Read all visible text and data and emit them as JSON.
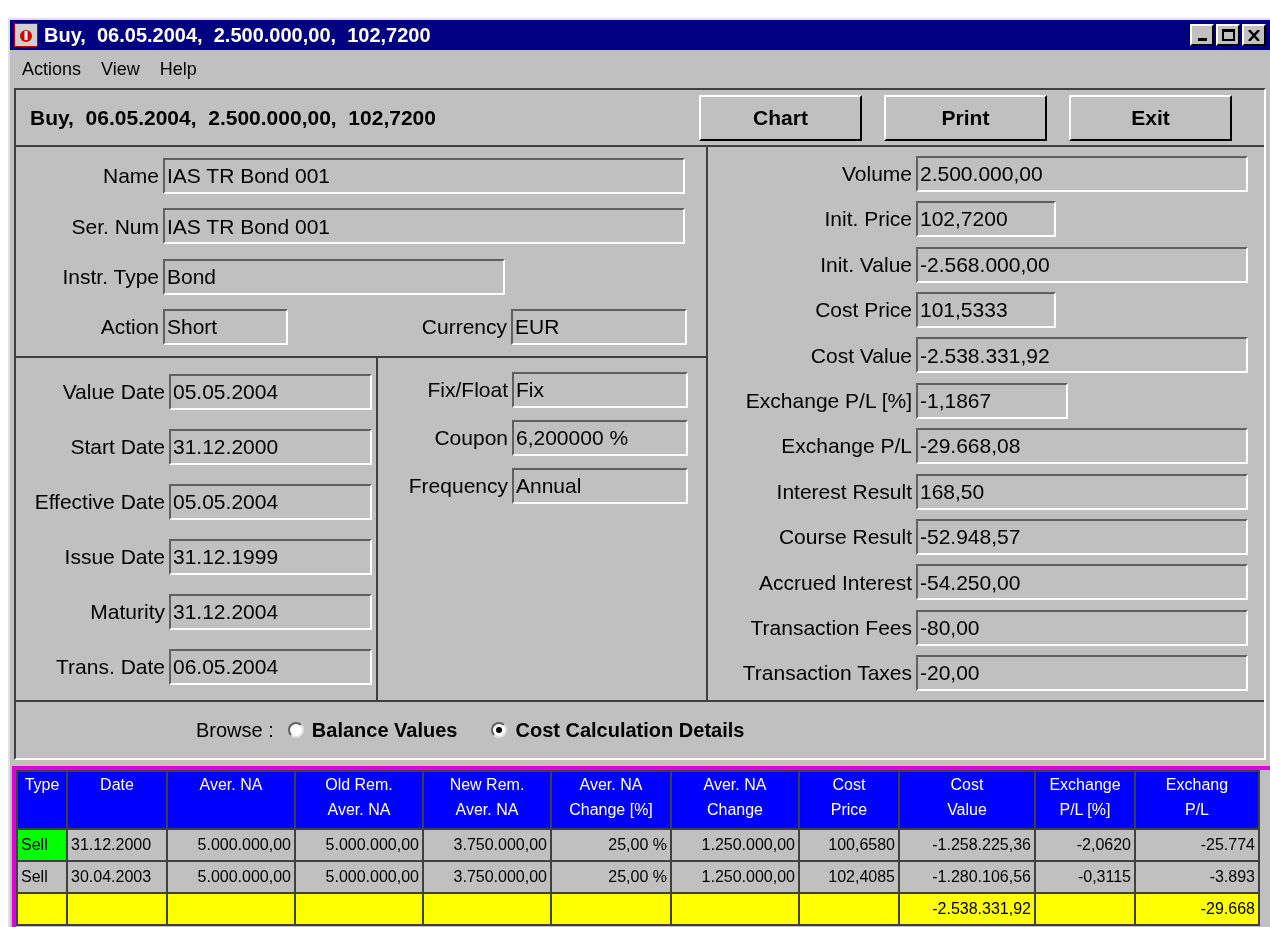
{
  "window": {
    "title": "Buy,  06.05.2004,  2.500.000,00,  102,7200"
  },
  "menu": [
    "Actions",
    "View",
    "Help"
  ],
  "header": {
    "title": "Buy,  06.05.2004,  2.500.000,00,  102,7200",
    "buttons": [
      "Chart",
      "Print",
      "Exit"
    ]
  },
  "instrument": {
    "fields": [
      {
        "label": "Name",
        "value": "IAS TR Bond 001"
      },
      {
        "label": "Ser. Num",
        "value": "IAS TR Bond 001"
      },
      {
        "label": "Instr. Type",
        "value": "Bond"
      },
      {
        "label": "Action",
        "value": "Short"
      },
      {
        "label": "Currency",
        "value": "EUR"
      }
    ]
  },
  "dates": [
    {
      "label": "Value Date",
      "value": "05.05.2004"
    },
    {
      "label": "Start Date",
      "value": "31.12.2000"
    },
    {
      "label": "Effective Date",
      "value": "05.05.2004"
    },
    {
      "label": "Issue Date",
      "value": "31.12.1999"
    },
    {
      "label": "Maturity",
      "value": "31.12.2004"
    },
    {
      "label": "Trans. Date",
      "value": "06.05.2004"
    }
  ],
  "terms": [
    {
      "label": "Fix/Float",
      "value": "Fix"
    },
    {
      "label": "Coupon",
      "value": "6,200000 %"
    },
    {
      "label": "Frequency",
      "value": "Annual"
    }
  ],
  "values": [
    {
      "label": "Volume",
      "value": "2.500.000,00"
    },
    {
      "label": "Init. Price",
      "value": "102,7200"
    },
    {
      "label": "Init. Value",
      "value": "-2.568.000,00"
    },
    {
      "label": "Cost Price",
      "value": "101,5333"
    },
    {
      "label": "Cost Value",
      "value": "-2.538.331,92"
    },
    {
      "label": "Exchange P/L [%]",
      "value": "-1,1867"
    },
    {
      "label": "Exchange P/L",
      "value": "-29.668,08"
    },
    {
      "label": "Interest Result",
      "value": "168,50"
    },
    {
      "label": "Course Result",
      "value": "-52.948,57"
    },
    {
      "label": "Accrued Interest",
      "value": "-54.250,00"
    },
    {
      "label": "Transaction Fees",
      "value": "-80,00"
    },
    {
      "label": "Transaction Taxes",
      "value": "-20,00"
    }
  ],
  "browse": {
    "label": "Browse :",
    "options": [
      {
        "label": "Balance Values",
        "selected": false
      },
      {
        "label": "Cost Calculation Details",
        "selected": true
      }
    ]
  },
  "table": {
    "columns": [
      "Type",
      "Date",
      "Aver. NA",
      "Old Rem.\nAver. NA",
      "New Rem.\nAver. NA",
      "Aver. NA\nChange [%]",
      "Aver. NA\nChange",
      "Cost\nPrice",
      "Cost\nValue",
      "Exchange\nP/L [%]",
      "Exchang\nP/L"
    ],
    "rows": [
      {
        "kind": "entry",
        "selected": true,
        "cells": [
          "Sell",
          "31.12.2000",
          "5.000.000,00",
          "5.000.000,00",
          "3.750.000,00",
          "25,00 %",
          "1.250.000,00",
          "100,6580",
          "-1.258.225,36",
          "-2,0620",
          "-25.774"
        ]
      },
      {
        "kind": "entry",
        "selected": false,
        "cells": [
          "Sell",
          "30.04.2003",
          "5.000.000,00",
          "5.000.000,00",
          "3.750.000,00",
          "25,00 %",
          "1.250.000,00",
          "102,4085",
          "-1.280.106,56",
          "-0,3115",
          "-3.893"
        ]
      },
      {
        "kind": "total",
        "cells": [
          "",
          "",
          "",
          "",
          "",
          "",
          "",
          "",
          "-2.538.331,92",
          "",
          "-29.668"
        ]
      }
    ]
  }
}
